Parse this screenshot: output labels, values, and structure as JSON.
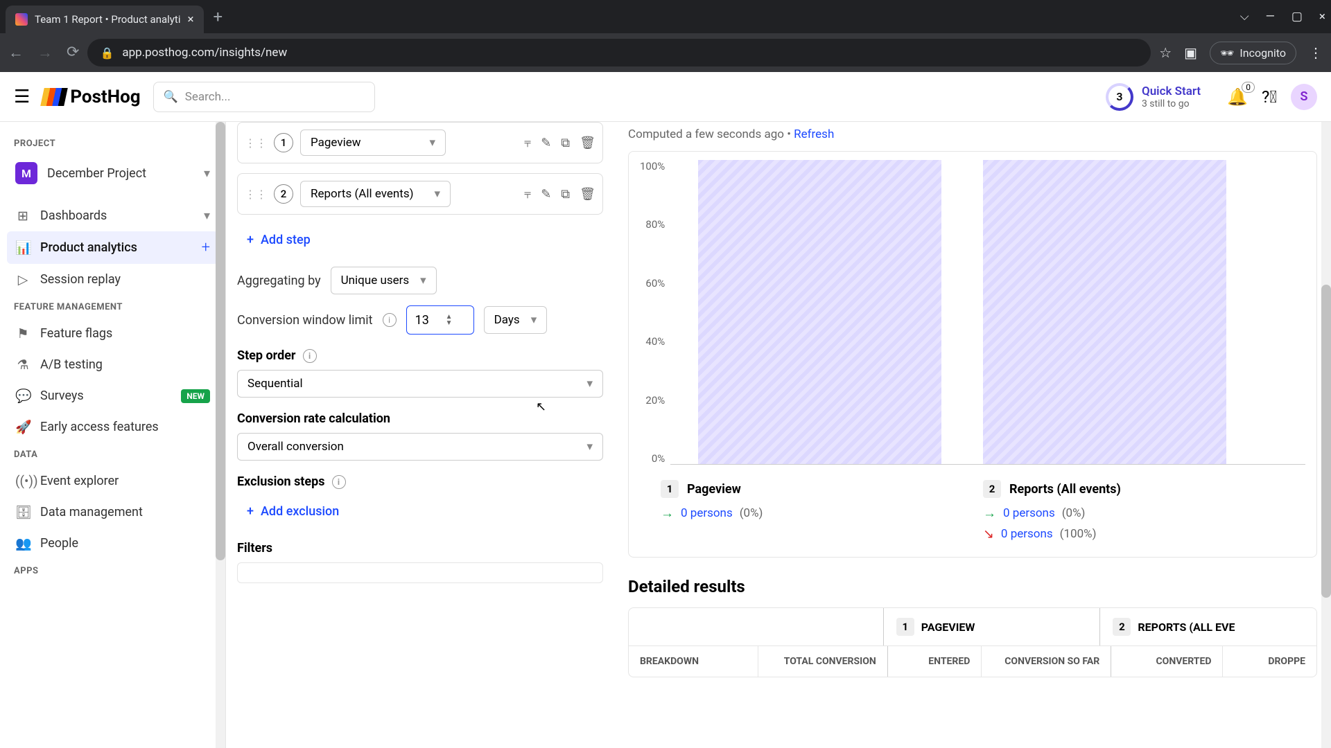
{
  "browser": {
    "tab_title": "Team 1 Report • Product analyti",
    "url": "app.posthog.com/insights/new",
    "incognito_label": "Incognito"
  },
  "header": {
    "logo": "PostHog",
    "search_placeholder": "Search...",
    "quickstart": {
      "count": "3",
      "title": "Quick Start",
      "subtitle": "3 still to go"
    },
    "bell_count": "0",
    "avatar_letter": "S"
  },
  "sidebar": {
    "sections": {
      "project": "PROJECT",
      "feature": "FEATURE MANAGEMENT",
      "data": "DATA",
      "apps": "APPS"
    },
    "project_badge": "M",
    "project_name": "December Project",
    "items": {
      "dashboards": "Dashboards",
      "product_analytics": "Product analytics",
      "session_replay": "Session replay",
      "feature_flags": "Feature flags",
      "ab_testing": "A/B testing",
      "surveys": "Surveys",
      "surveys_badge": "NEW",
      "early_access": "Early access features",
      "event_explorer": "Event explorer",
      "data_management": "Data management",
      "people": "People"
    }
  },
  "config": {
    "steps": [
      {
        "num": "1",
        "label": "Pageview"
      },
      {
        "num": "2",
        "label": "Reports (All events)"
      }
    ],
    "add_step": "Add step",
    "aggregating_label": "Aggregating by",
    "aggregating_value": "Unique users",
    "cwl_label": "Conversion window limit",
    "cwl_value": "13",
    "cwl_unit": "Days",
    "step_order_label": "Step order",
    "step_order_value": "Sequential",
    "crc_label": "Conversion rate calculation",
    "crc_value": "Overall conversion",
    "excl_label": "Exclusion steps",
    "add_exclusion": "Add exclusion",
    "filters_label": "Filters"
  },
  "results": {
    "computed_prefix": "Computed a few seconds ago • ",
    "refresh": "Refresh",
    "y_ticks": [
      "100%",
      "80%",
      "60%",
      "40%",
      "20%",
      "0%"
    ],
    "legend": [
      {
        "num": "1",
        "name": "Pageview",
        "rows": [
          {
            "arrow": "green",
            "persons": "0 persons",
            "pct": "(0%)"
          }
        ]
      },
      {
        "num": "2",
        "name": "Reports (All events)",
        "rows": [
          {
            "arrow": "green",
            "persons": "0 persons",
            "pct": "(0%)"
          },
          {
            "arrow": "red",
            "persons": "0 persons",
            "pct": "(100%)"
          }
        ]
      }
    ],
    "detailed_heading": "Detailed results",
    "table_groups": [
      {
        "num": "1",
        "name": "PAGEVIEW"
      },
      {
        "num": "2",
        "name": "REPORTS (ALL EVE"
      }
    ],
    "columns": {
      "breakdown": "BREAKDOWN",
      "total_conv": "TOTAL CONVERSION",
      "entered": "ENTERED",
      "conv_so_far": "CONVERSION SO FAR",
      "converted": "CONVERTED",
      "dropped": "DROPPE"
    }
  },
  "chart_data": {
    "type": "bar",
    "categories": [
      "Pageview",
      "Reports (All events)"
    ],
    "values": [
      100,
      100
    ],
    "ylabel": "%",
    "ylim": [
      0,
      100
    ],
    "note": "Bars rendered at 100% height as placeholders; legend reports 0 persons / 0% conversion."
  }
}
